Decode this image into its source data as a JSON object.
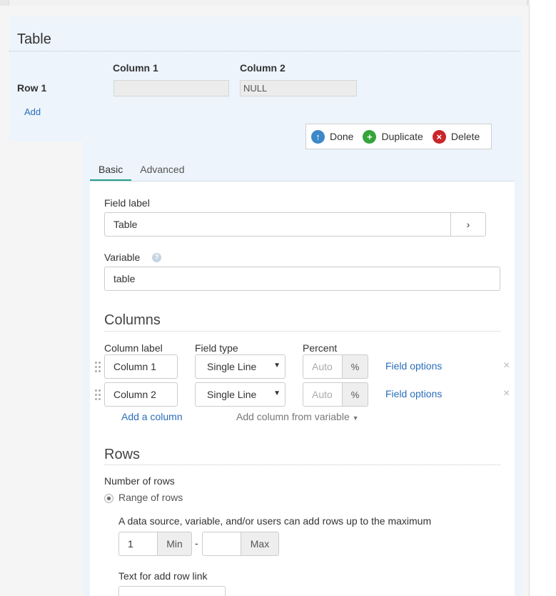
{
  "preview": {
    "title": "Table",
    "columns": [
      "Column 1",
      "Column 2"
    ],
    "row_label": "Row 1",
    "cells": [
      "",
      "NULL"
    ],
    "add_label": "Add"
  },
  "toolbar": {
    "done_label": "Done",
    "duplicate_label": "Duplicate",
    "delete_label": "Delete"
  },
  "tabs": [
    {
      "label": "Basic",
      "active": true
    },
    {
      "label": "Advanced",
      "active": false
    }
  ],
  "basic": {
    "field_label_label": "Field label",
    "field_label_value": "Table",
    "expand_glyph": "›",
    "variable_label": "Variable",
    "variable_value": "table"
  },
  "columns_section": {
    "title": "Columns",
    "headers": {
      "column_label": "Column label",
      "field_type": "Field type",
      "percent": "Percent"
    },
    "rows": [
      {
        "label": "Column 1",
        "field_type": "Single Line",
        "percent_placeholder": "Auto",
        "percent_addon": "%",
        "options_link": "Field options"
      },
      {
        "label": "Column 2",
        "field_type": "Single Line",
        "percent_placeholder": "Auto",
        "percent_addon": "%",
        "options_link": "Field options"
      }
    ],
    "add_column": "Add a column",
    "add_from_variable": "Add column from variable"
  },
  "rows_section": {
    "title": "Rows",
    "number_of_rows_label": "Number of rows",
    "radio_label": "Range of rows",
    "range_description": "A data source, variable, and/or users can add rows up to the maximum",
    "min_value": "1",
    "min_addon": "Min",
    "separator": "-",
    "max_value": "",
    "max_addon": "Max",
    "add_row_link_label": "Text for add row link"
  },
  "colors": {
    "accent_tab": "#24a08f",
    "link": "#2a6ebb",
    "done": "#3c88c9",
    "duplicate": "#34a43b",
    "delete": "#c9262b"
  }
}
